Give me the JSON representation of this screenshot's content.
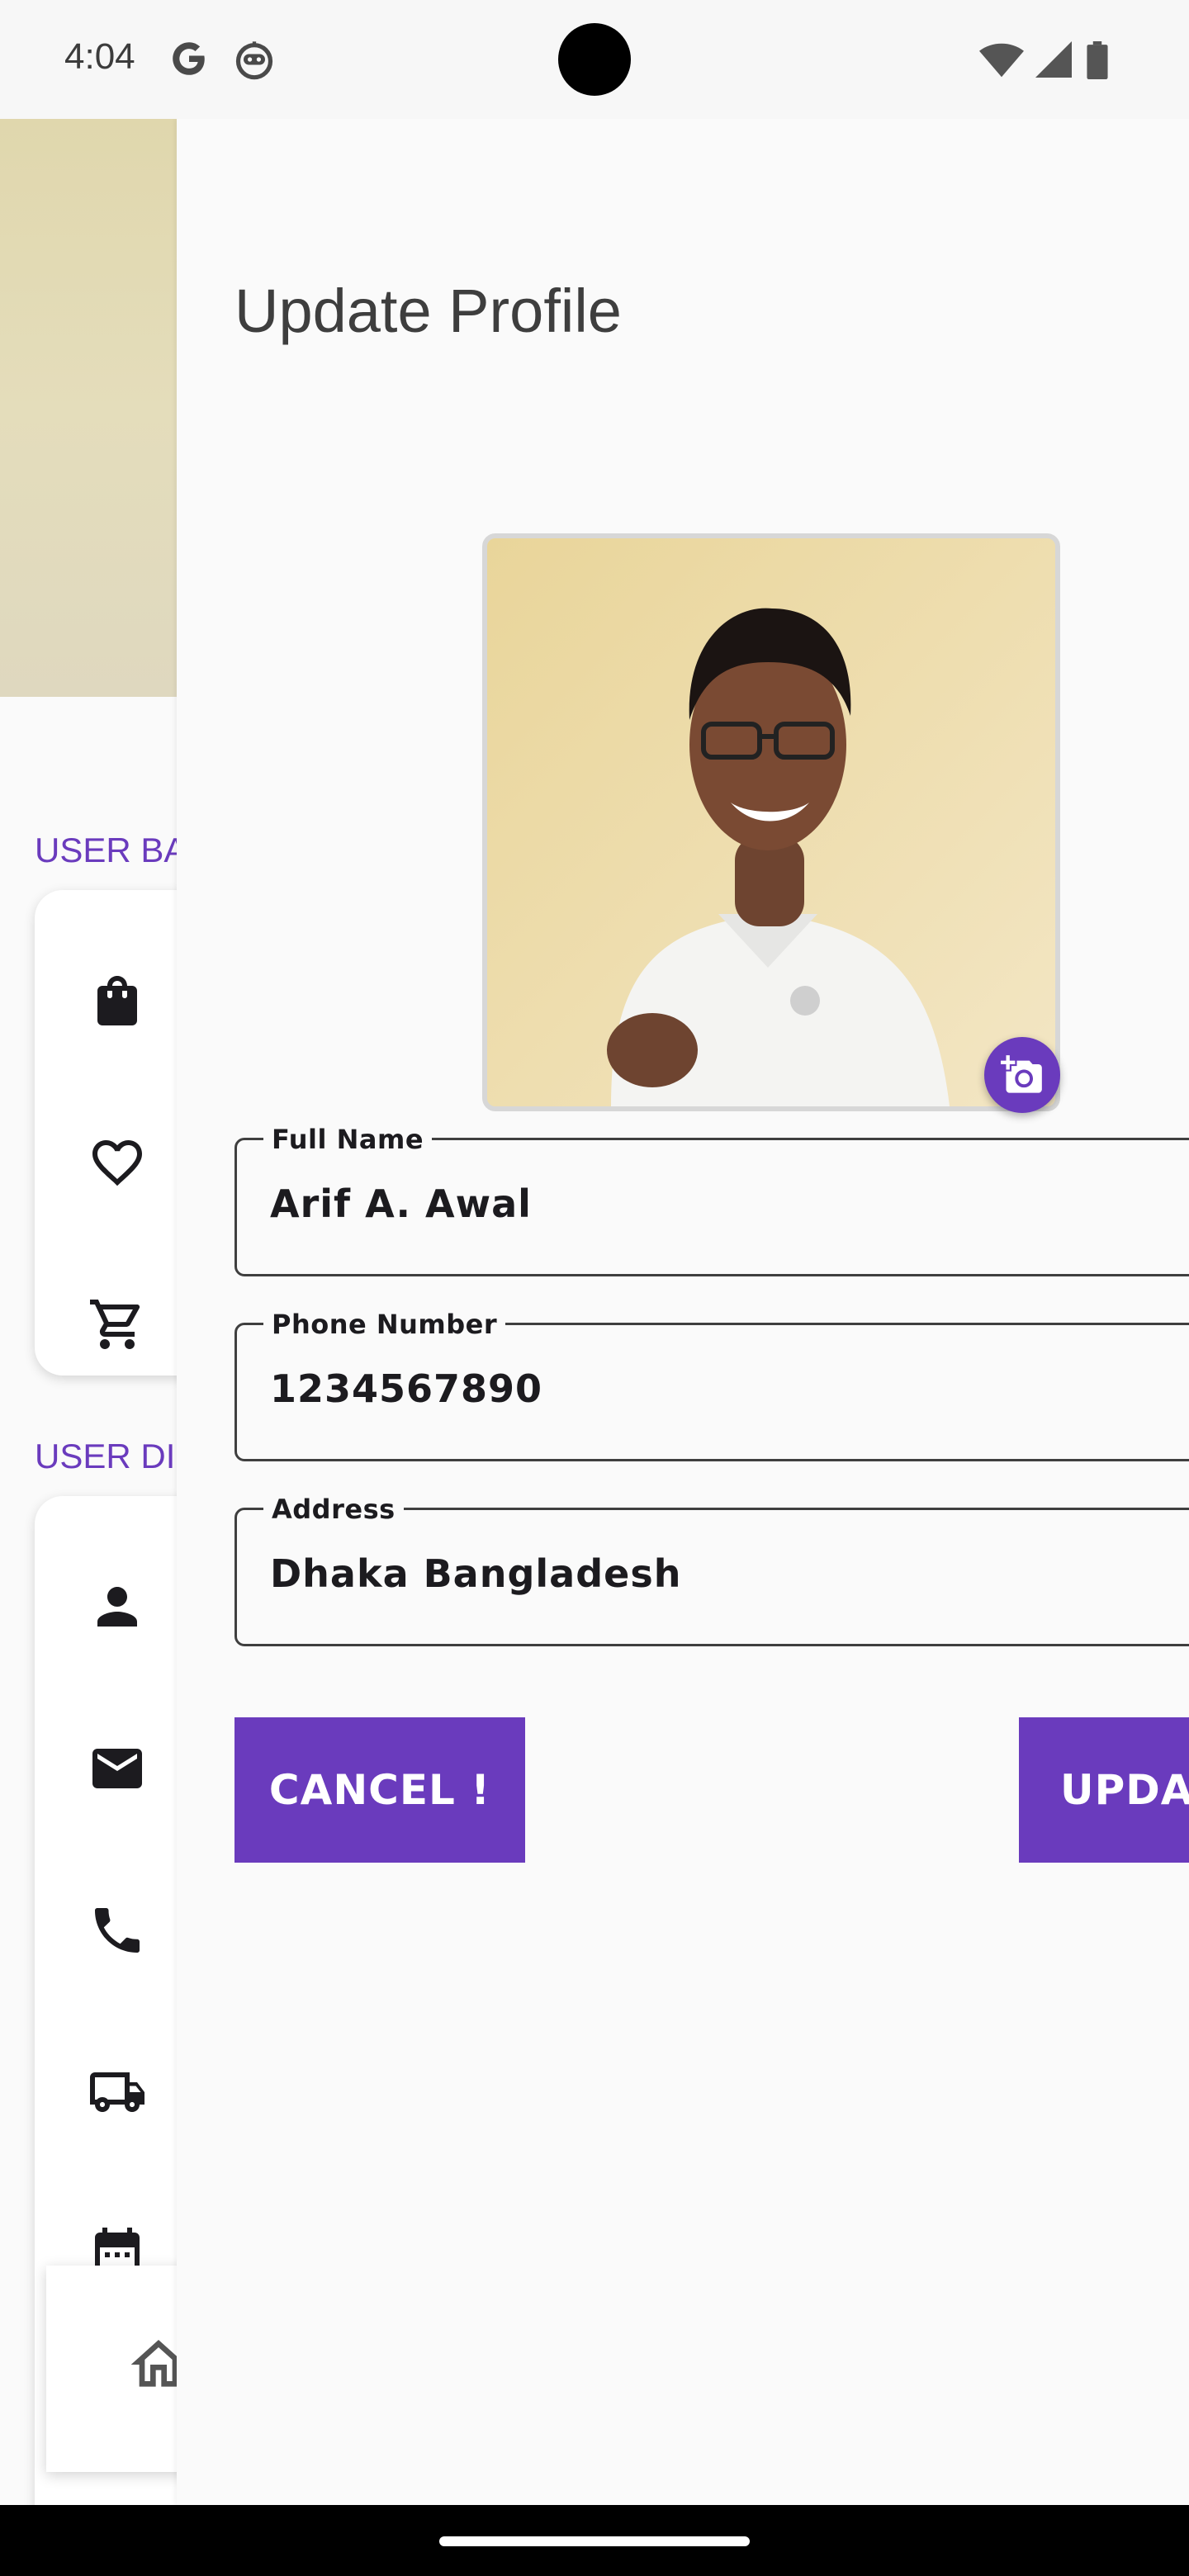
{
  "status_bar": {
    "time": "4:04",
    "icons": [
      "google-icon",
      "bot-icon",
      "wifi-icon",
      "signal-icon",
      "battery-icon"
    ]
  },
  "background_screen": {
    "section_user_bag": "USER BA",
    "bag_items": [
      {
        "icon": "shopping-bag-icon"
      },
      {
        "icon": "heart-icon"
      },
      {
        "icon": "cart-icon"
      }
    ],
    "section_user_details": "USER DI",
    "detail_items": [
      {
        "icon": "person-icon"
      },
      {
        "icon": "mail-icon"
      },
      {
        "icon": "phone-icon"
      },
      {
        "icon": "truck-icon"
      },
      {
        "icon": "calendar-icon"
      }
    ],
    "bottom_nav": {
      "icon": "home-icon"
    }
  },
  "profile": {
    "title": "Update Profile",
    "photo_button_icon": "add-a-photo-icon",
    "fields": {
      "full_name": {
        "label": "Full Name",
        "value": "Arif A. Awal"
      },
      "phone": {
        "label": "Phone Number",
        "value": "1234567890"
      },
      "address": {
        "label": "Address",
        "value": "Dhaka Bangladesh"
      }
    },
    "buttons": {
      "cancel": "CANCEL !",
      "update": "UPDAT"
    }
  },
  "colors": {
    "accent": "#6A3BBD",
    "background": "#FAFAFA",
    "outline": "#3F3F3F"
  }
}
